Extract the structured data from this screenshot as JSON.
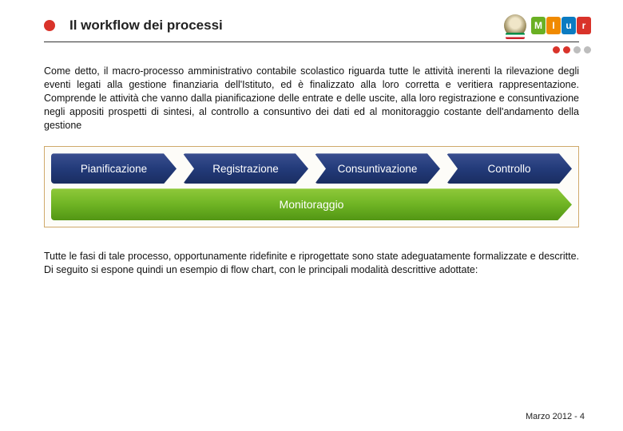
{
  "header": {
    "title": "Il workflow dei processi",
    "logo_letters": [
      "M",
      "I",
      "u",
      "r"
    ]
  },
  "paragraph1": "Come detto, il macro-processo amministrativo contabile scolastico riguarda tutte le attività inerenti la rilevazione degli eventi legati alla gestione finanziaria dell'Istituto, ed è finalizzato alla loro corretta e veritiera rappresentazione. Comprende le attività che vanno dalla pianificazione delle entrate e delle uscite, alla loro registrazione e consuntivazione negli appositi prospetti di sintesi, al controllo a consuntivo dei dati ed al monitoraggio costante dell'andamento della gestione",
  "diagram": {
    "steps": [
      "Pianificazione",
      "Registrazione",
      "Consuntivazione",
      "Controllo"
    ],
    "monitor": "Monitoraggio"
  },
  "paragraph2": "Tutte le fasi di tale processo, opportunamente ridefinite e riprogettate sono state adeguatamente formalizzate e descritte. Di seguito si espone quindi un esempio di flow chart, con le principali modalità descrittive adottate:",
  "footer": "Marzo 2012 - 4"
}
